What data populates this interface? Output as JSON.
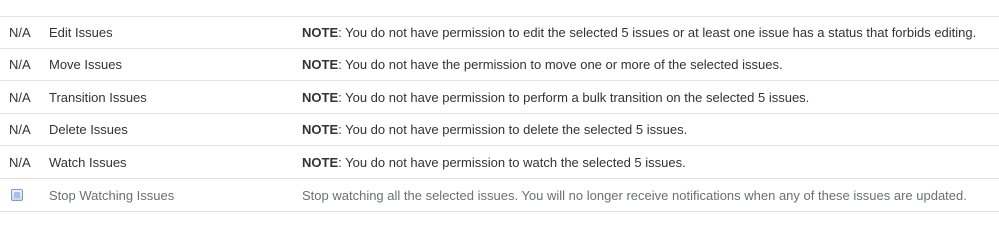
{
  "operations": [
    {
      "status": "N/A",
      "name": "Edit Issues",
      "note_label": "NOTE",
      "description": ": You do not have permission to edit the selected 5 issues or at least one issue has a status that forbids editing."
    },
    {
      "status": "N/A",
      "name": "Move Issues",
      "note_label": "NOTE",
      "description": ": You do not have the permission to move one or more of the selected issues."
    },
    {
      "status": "N/A",
      "name": "Transition Issues",
      "note_label": "NOTE",
      "description": ": You do not have permission to perform a bulk transition on the selected 5 issues."
    },
    {
      "status": "N/A",
      "name": "Delete Issues",
      "note_label": "NOTE",
      "description": ": You do not have permission to delete the selected 5 issues."
    },
    {
      "status": "N/A",
      "name": "Watch Issues",
      "note_label": "NOTE",
      "description": ": You do not have permission to watch the selected 5 issues."
    },
    {
      "status_icon": "radio-button-icon",
      "name": "Stop Watching Issues",
      "description": "Stop watching all the selected issues. You will no longer receive notifications when any of these issues are updated."
    }
  ]
}
